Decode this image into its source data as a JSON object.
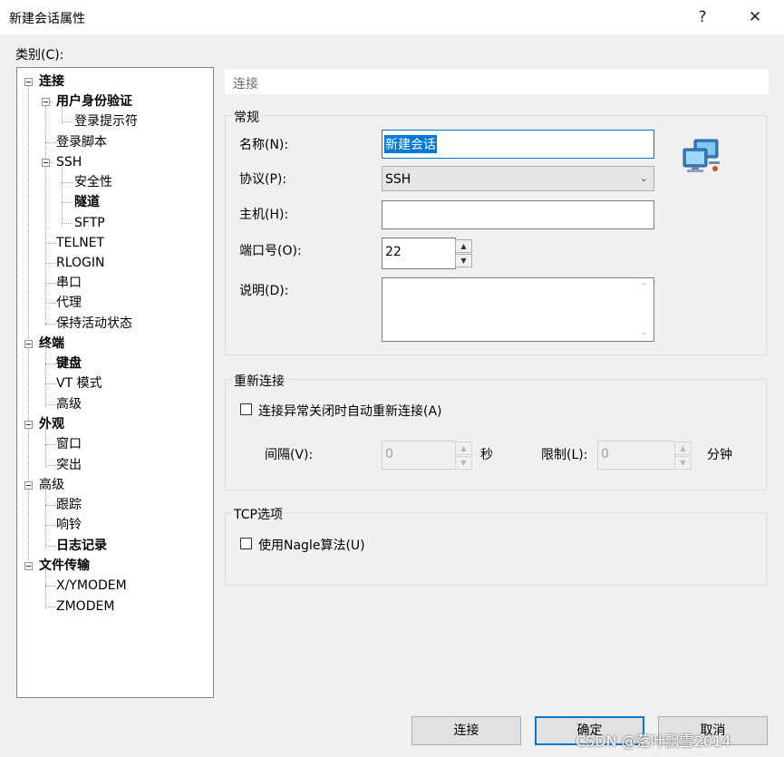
{
  "window": {
    "title": "新建会话属性",
    "help": "?",
    "close": "✕"
  },
  "category_label": "类别(C):",
  "tree": [
    {
      "label": "连接",
      "bold": true
    },
    {
      "label": "用户身份验证",
      "bold": true
    },
    {
      "label": "登录提示符",
      "bold": false
    },
    {
      "label": "登录脚本",
      "bold": false
    },
    {
      "label": "SSH",
      "bold": false
    },
    {
      "label": "安全性",
      "bold": false
    },
    {
      "label": "隧道",
      "bold": true
    },
    {
      "label": "SFTP",
      "bold": false
    },
    {
      "label": "TELNET",
      "bold": false
    },
    {
      "label": "RLOGIN",
      "bold": false
    },
    {
      "label": "串口",
      "bold": false
    },
    {
      "label": "代理",
      "bold": false
    },
    {
      "label": "保持活动状态",
      "bold": false
    },
    {
      "label": "终端",
      "bold": true
    },
    {
      "label": "键盘",
      "bold": true
    },
    {
      "label": "VT 模式",
      "bold": false
    },
    {
      "label": "高级",
      "bold": false
    },
    {
      "label": "外观",
      "bold": true
    },
    {
      "label": "窗口",
      "bold": false
    },
    {
      "label": "突出",
      "bold": false
    },
    {
      "label": "高级",
      "bold": false
    },
    {
      "label": "跟踪",
      "bold": false
    },
    {
      "label": "响铃",
      "bold": false
    },
    {
      "label": "日志记录",
      "bold": true
    },
    {
      "label": "文件传输",
      "bold": true
    },
    {
      "label": "X/YMODEM",
      "bold": false
    },
    {
      "label": "ZMODEM",
      "bold": false
    }
  ],
  "header": "连接",
  "general": {
    "title": "常规",
    "name_label": "名称(N):",
    "name_value": "新建会话",
    "protocol_label": "协议(P):",
    "protocol_value": "SSH",
    "host_label": "主机(H):",
    "host_value": "",
    "port_label": "端口号(O):",
    "port_value": "22",
    "desc_label": "说明(D):",
    "desc_value": ""
  },
  "reconnect": {
    "title": "重新连接",
    "checkbox_label": "连接异常关闭时自动重新连接(A)",
    "interval_label": "间隔(V):",
    "interval_value": "0",
    "interval_unit": "秒",
    "limit_label": "限制(L):",
    "limit_value": "0",
    "limit_unit": "分钟"
  },
  "tcp": {
    "title": "TCP选项",
    "checkbox_label": "使用Nagle算法(U)"
  },
  "buttons": {
    "connect": "连接",
    "ok": "确定",
    "cancel": "取消"
  },
  "watermark": "CSDN @落叶飘雪2014",
  "colors": {
    "accent": "#0078d7",
    "background": "#f0f0f0"
  },
  "icons": {
    "session": "network-computers-icon",
    "spin_up": "▲",
    "spin_down": "▼",
    "dropdown": "chevron-down-icon"
  }
}
